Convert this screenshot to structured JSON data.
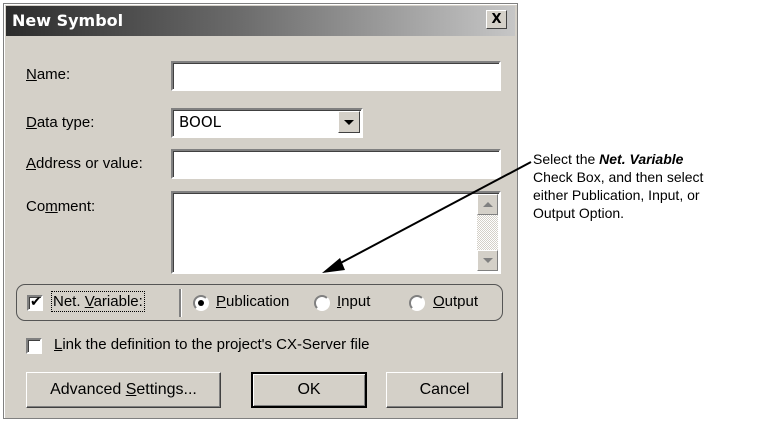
{
  "dialog": {
    "title": "New Symbol",
    "close_glyph": "X",
    "name": {
      "label_pre": "",
      "label_ul": "N",
      "label_post": "ame:",
      "value": ""
    },
    "data_type": {
      "label_pre": "",
      "label_ul": "D",
      "label_post": "ata type:",
      "value": "BOOL"
    },
    "address": {
      "label_pre": "",
      "label_ul": "A",
      "label_post": "ddress or value:",
      "value": ""
    },
    "comment": {
      "label_pre": "Co",
      "label_ul": "m",
      "label_post": "ment:",
      "value": ""
    },
    "net_variable": {
      "checked": true,
      "label_pre": "Net. ",
      "label_ul": "V",
      "label_post": "ariable:",
      "options": [
        {
          "ul": "P",
          "rest": "ublication",
          "selected": true
        },
        {
          "ul": "I",
          "rest": "nput",
          "selected": false
        },
        {
          "ul": "O",
          "rest": "utput",
          "selected": false
        }
      ]
    },
    "link": {
      "checked": false,
      "label_ul": "L",
      "label_post": "ink the definition to the project's CX-Server file"
    },
    "buttons": {
      "advanced": {
        "pre": "Advanced ",
        "ul": "S",
        "post": "ettings..."
      },
      "ok": "OK",
      "cancel": "Cancel"
    }
  },
  "annotation": {
    "line1_pre": "Select the ",
    "line1_bold": "Net. Variable",
    "line2": "Check Box, and then select",
    "line3": "either Publication, Input, or",
    "line4": "Output Option."
  }
}
